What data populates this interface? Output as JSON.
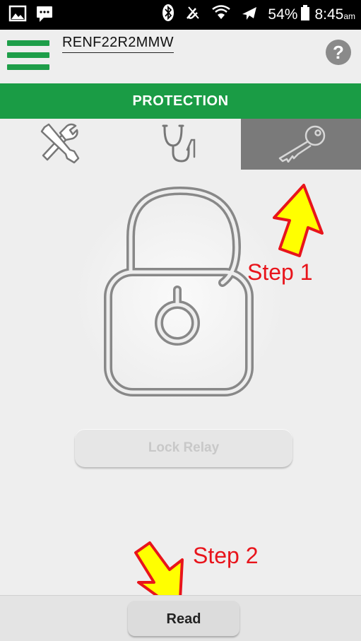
{
  "status_bar": {
    "battery_percent": "54%",
    "time": "8:45",
    "time_suffix": "am",
    "icons": [
      "image-icon",
      "message-icon",
      "bluetooth-icon",
      "mute-icon",
      "wifi-icon",
      "airplane-icon",
      "battery-icon"
    ]
  },
  "header": {
    "device_name": "RENF22R2MMW",
    "help_label": "?"
  },
  "banner": {
    "title": "PROTECTION"
  },
  "tabs": [
    {
      "name": "settings",
      "icon": "tools-icon",
      "active": false
    },
    {
      "name": "diagnostics",
      "icon": "stethoscope-icon",
      "active": false
    },
    {
      "name": "protection",
      "icon": "key-icon",
      "active": true
    }
  ],
  "main": {
    "lock_state": "unlocked-padlock-icon",
    "lock_relay_label": "Lock Relay"
  },
  "annotations": {
    "step1": "Step 1",
    "step2": "Step 2"
  },
  "footer": {
    "read_label": "Read"
  },
  "colors": {
    "brand_green": "#1a9c45",
    "active_tab": "#7a7a7a",
    "annotation_red": "#e8141b",
    "arrow_yellow": "#ffff00"
  }
}
